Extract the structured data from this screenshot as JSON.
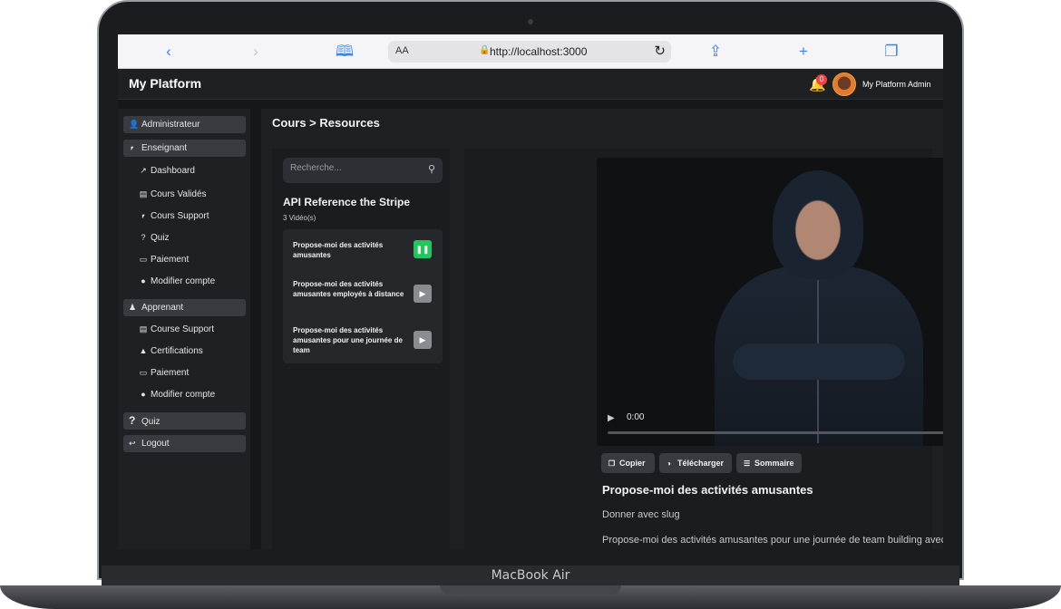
{
  "device": {
    "label": "MacBook Air"
  },
  "browser": {
    "text_size_label": "AA",
    "url": "http://localhost:3000"
  },
  "header": {
    "app_title": "My Platform",
    "notification_count": "0",
    "user_name": "My Platform Admin"
  },
  "sidebar": {
    "groups": [
      {
        "label": "Administrateur"
      },
      {
        "label": "Enseignant"
      },
      {
        "label": "Apprenant"
      },
      {
        "label": "Quiz"
      },
      {
        "label": "Logout"
      }
    ],
    "enseignant_items": [
      {
        "label": "Dashboard"
      },
      {
        "label": "Cours Validés"
      },
      {
        "label": "Cours Support"
      },
      {
        "label": "Quiz"
      },
      {
        "label": "Paiement"
      },
      {
        "label": "Modifier compte"
      }
    ],
    "apprenant_items": [
      {
        "label": "Course Support"
      },
      {
        "label": "Certifications"
      },
      {
        "label": "Paiement"
      },
      {
        "label": "Modifier compte"
      }
    ]
  },
  "main": {
    "breadcrumb": "Cours > Resources",
    "search": {
      "placeholder": "Recherche..."
    },
    "course": {
      "title": "API Reference the Stripe",
      "video_count": "3 Vidéo(s)",
      "videos": [
        {
          "title": "Propose-moi des activités amusantes",
          "state": "playing"
        },
        {
          "title": "Propose-moi des activités amusantes employés à distance",
          "state": "idle"
        },
        {
          "title": "Propose-moi des activités amusantes pour une journée de team",
          "state": "idle"
        }
      ]
    },
    "player": {
      "time": "0:00",
      "progress": 0
    },
    "actions": {
      "copy": "Copier",
      "download": "Télécharger",
      "summary": "Sommaire"
    },
    "current_video": {
      "title": "Propose-moi des activités amusantes",
      "slug": "Donner avec slug",
      "description": "Propose-moi des activités amusantes pour une journée de team building avec des"
    }
  },
  "colors": {
    "accent_blue": "#3b82f6",
    "playing_green": "#22c55e",
    "badge_red": "#ef4444",
    "panel_dark": "#1f2024"
  }
}
